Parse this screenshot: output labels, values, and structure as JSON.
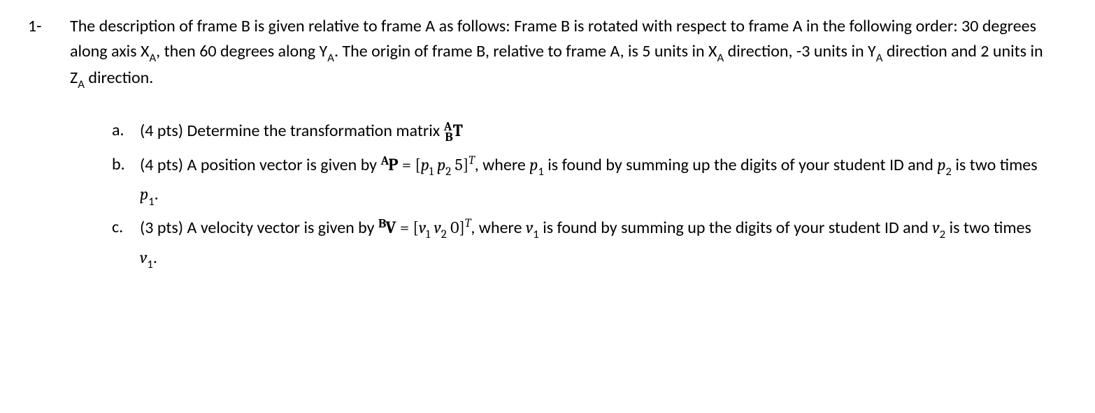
{
  "question": {
    "number": "1-",
    "text_parts": {
      "p0": "The description of frame B is given relative to frame A as follows: Frame B is rotated with respect to frame A in the following order: 30 degrees along axis X",
      "p1": "A",
      "p2": ", then 60 degrees along Y",
      "p3": "A",
      "p4": ". The origin of frame B, relative to frame A, is 5 units in X",
      "p5": "A",
      "p6": " direction, -3 units in Y",
      "p7": "A",
      "p8": " direction and 2 units in Z",
      "p9": "A",
      "p10": " direction."
    },
    "subparts": {
      "a": {
        "label": "a.",
        "t0": "(4 pts) Determine the transformation matrix ",
        "sA": "A",
        "sB": "B",
        "T": "T"
      },
      "b": {
        "label": "b.",
        "t0": "(4 pts) A position vector is given by ",
        "sA": "A",
        "P": "P",
        "eq": " = [",
        "p1": "p",
        "one": "1",
        "sp": "  ",
        "p2": "p",
        "two": "2",
        "five": "  5]",
        "T": "T",
        "t1": ", where ",
        "pp1": "p",
        "pone": "1",
        "t2": " is found by summing up the digits of your student ID and ",
        "pp2": "p",
        "ptwo": "2",
        "t3": " is two times ",
        "pp3": "p",
        "pthree": "1",
        "t4": "."
      },
      "c": {
        "label": "c.",
        "t0": "(3 pts) A velocity vector is given by  ",
        "sB": "B",
        "V": "V",
        "eq": " = [",
        "v1": "v",
        "one": "1",
        "sp": "  ",
        "v2": "v",
        "two": "2",
        "zero": "  0]",
        "T": "T",
        "t1": ", where ",
        "vv1": "v",
        "vone": "1",
        "t2": " is found by summing up the digits of your student ID and ",
        "vv2": "v",
        "vtwo": "2",
        "t3": " is two times ",
        "vv3": "v",
        "vthree": "1",
        "t4": "."
      }
    }
  }
}
